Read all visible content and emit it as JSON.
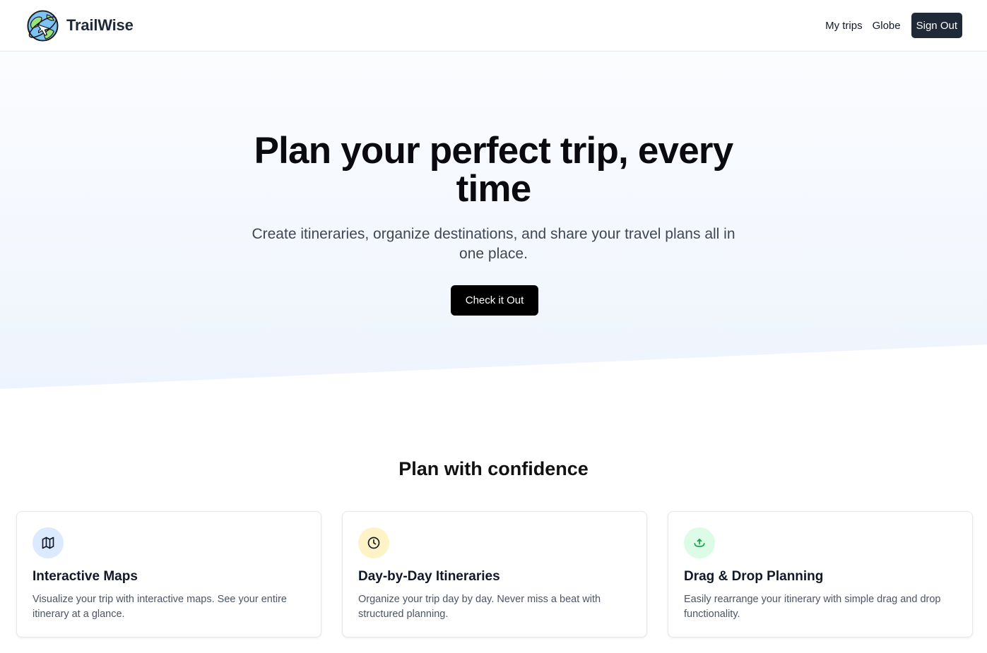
{
  "header": {
    "brand_name": "TrailWise",
    "nav": {
      "my_trips": "My trips",
      "globe": "Globe"
    },
    "sign_out": "Sign Out"
  },
  "hero": {
    "title_lines": [
      "Plan your perfect trip, every",
      "time"
    ],
    "subtitle_lines": [
      "Create itineraries, organize destinations, and share your travel plans all in",
      "one place."
    ],
    "cta": "Check it Out"
  },
  "features": {
    "title": "Plan with confidence",
    "cards": [
      {
        "icon": "map-icon",
        "icon_bg": "#dbeafe",
        "title": "Interactive Maps",
        "text_lines": [
          "Visualize your trip with interactive maps. See your entire",
          "itinerary at a glance."
        ]
      },
      {
        "icon": "clock-icon",
        "icon_bg": "#fef3c7",
        "title": "Day-by-Day Itineraries",
        "text_lines": [
          "Organize your trip day by day. Never miss a beat with",
          "structured planning."
        ]
      },
      {
        "icon": "drag-drop-icon",
        "icon_bg": "#dcfce7",
        "title": "Drag & Drop Planning",
        "text_lines": [
          "Easily rearrange your itinerary with simple drag and drop",
          "functionality."
        ]
      }
    ]
  },
  "colors": {
    "primary_button": "#000000",
    "nav_button": "#1f2937",
    "hero_gradient_bottom": "#eef4fd"
  }
}
